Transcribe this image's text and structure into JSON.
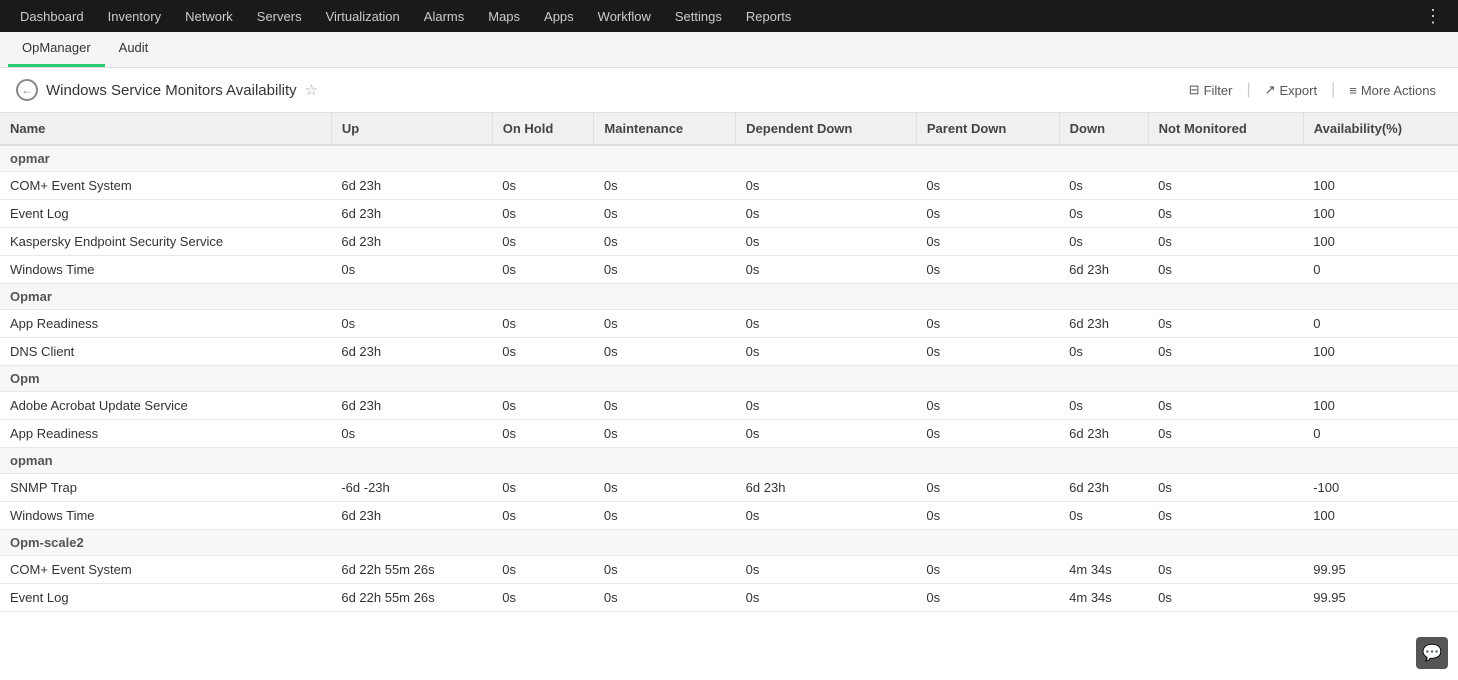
{
  "topnav": {
    "items": [
      {
        "label": "Dashboard",
        "id": "dashboard"
      },
      {
        "label": "Inventory",
        "id": "inventory"
      },
      {
        "label": "Network",
        "id": "network"
      },
      {
        "label": "Servers",
        "id": "servers"
      },
      {
        "label": "Virtualization",
        "id": "virtualization"
      },
      {
        "label": "Alarms",
        "id": "alarms"
      },
      {
        "label": "Maps",
        "id": "maps"
      },
      {
        "label": "Apps",
        "id": "apps"
      },
      {
        "label": "Workflow",
        "id": "workflow"
      },
      {
        "label": "Settings",
        "id": "settings"
      },
      {
        "label": "Reports",
        "id": "reports"
      }
    ],
    "more_icon": "⋮"
  },
  "subnav": {
    "items": [
      {
        "label": "OpManager",
        "active": true
      },
      {
        "label": "Audit",
        "active": false
      }
    ]
  },
  "header": {
    "title": "Windows Service Monitors Availability",
    "back_label": "←",
    "star_label": "☆",
    "filter_label": "Filter",
    "export_label": "Export",
    "more_actions_label": "More Actions",
    "separator": "|"
  },
  "table": {
    "columns": [
      "Name",
      "Up",
      "On Hold",
      "Maintenance",
      "Dependent Down",
      "Parent Down",
      "Down",
      "Not Monitored",
      "Availability(%)"
    ],
    "groups": [
      {
        "group_name": "opmar",
        "rows": [
          {
            "name": "COM+ Event System",
            "up": "6d 23h",
            "on_hold": "0s",
            "maintenance": "0s",
            "dependent_down": "0s",
            "parent_down": "0s",
            "down": "0s",
            "not_monitored": "0s",
            "availability": "100"
          },
          {
            "name": "Event Log",
            "up": "6d 23h",
            "on_hold": "0s",
            "maintenance": "0s",
            "dependent_down": "0s",
            "parent_down": "0s",
            "down": "0s",
            "not_monitored": "0s",
            "availability": "100"
          },
          {
            "name": "Kaspersky Endpoint Security Service",
            "up": "6d 23h",
            "on_hold": "0s",
            "maintenance": "0s",
            "dependent_down": "0s",
            "parent_down": "0s",
            "down": "0s",
            "not_monitored": "0s",
            "availability": "100"
          },
          {
            "name": "Windows Time",
            "up": "0s",
            "on_hold": "0s",
            "maintenance": "0s",
            "dependent_down": "0s",
            "parent_down": "0s",
            "down": "6d 23h",
            "not_monitored": "0s",
            "availability": "0"
          }
        ]
      },
      {
        "group_name": "Opmar",
        "rows": [
          {
            "name": "App Readiness",
            "up": "0s",
            "on_hold": "0s",
            "maintenance": "0s",
            "dependent_down": "0s",
            "parent_down": "0s",
            "down": "6d 23h",
            "not_monitored": "0s",
            "availability": "0"
          },
          {
            "name": "DNS Client",
            "up": "6d 23h",
            "on_hold": "0s",
            "maintenance": "0s",
            "dependent_down": "0s",
            "parent_down": "0s",
            "down": "0s",
            "not_monitored": "0s",
            "availability": "100"
          }
        ]
      },
      {
        "group_name": "Opm",
        "rows": [
          {
            "name": "Adobe Acrobat Update Service",
            "up": "6d 23h",
            "on_hold": "0s",
            "maintenance": "0s",
            "dependent_down": "0s",
            "parent_down": "0s",
            "down": "0s",
            "not_monitored": "0s",
            "availability": "100"
          },
          {
            "name": "App Readiness",
            "up": "0s",
            "on_hold": "0s",
            "maintenance": "0s",
            "dependent_down": "0s",
            "parent_down": "0s",
            "down": "6d 23h",
            "not_monitored": "0s",
            "availability": "0"
          }
        ]
      },
      {
        "group_name": "opman",
        "rows": [
          {
            "name": "SNMP Trap",
            "up": "-6d -23h",
            "on_hold": "0s",
            "maintenance": "0s",
            "dependent_down": "6d 23h",
            "parent_down": "0s",
            "down": "6d 23h",
            "not_monitored": "0s",
            "availability": "-100"
          },
          {
            "name": "Windows Time",
            "up": "6d 23h",
            "on_hold": "0s",
            "maintenance": "0s",
            "dependent_down": "0s",
            "parent_down": "0s",
            "down": "0s",
            "not_monitored": "0s",
            "availability": "100"
          }
        ]
      },
      {
        "group_name": "Opm-scale2",
        "rows": [
          {
            "name": "COM+ Event System",
            "up": "6d 22h 55m 26s",
            "on_hold": "0s",
            "maintenance": "0s",
            "dependent_down": "0s",
            "parent_down": "0s",
            "down": "4m 34s",
            "not_monitored": "0s",
            "availability": "99.95"
          },
          {
            "name": "Event Log",
            "up": "6d 22h 55m 26s",
            "on_hold": "0s",
            "maintenance": "0s",
            "dependent_down": "0s",
            "parent_down": "0s",
            "down": "4m 34s",
            "not_monitored": "0s",
            "availability": "99.95"
          }
        ]
      }
    ]
  }
}
